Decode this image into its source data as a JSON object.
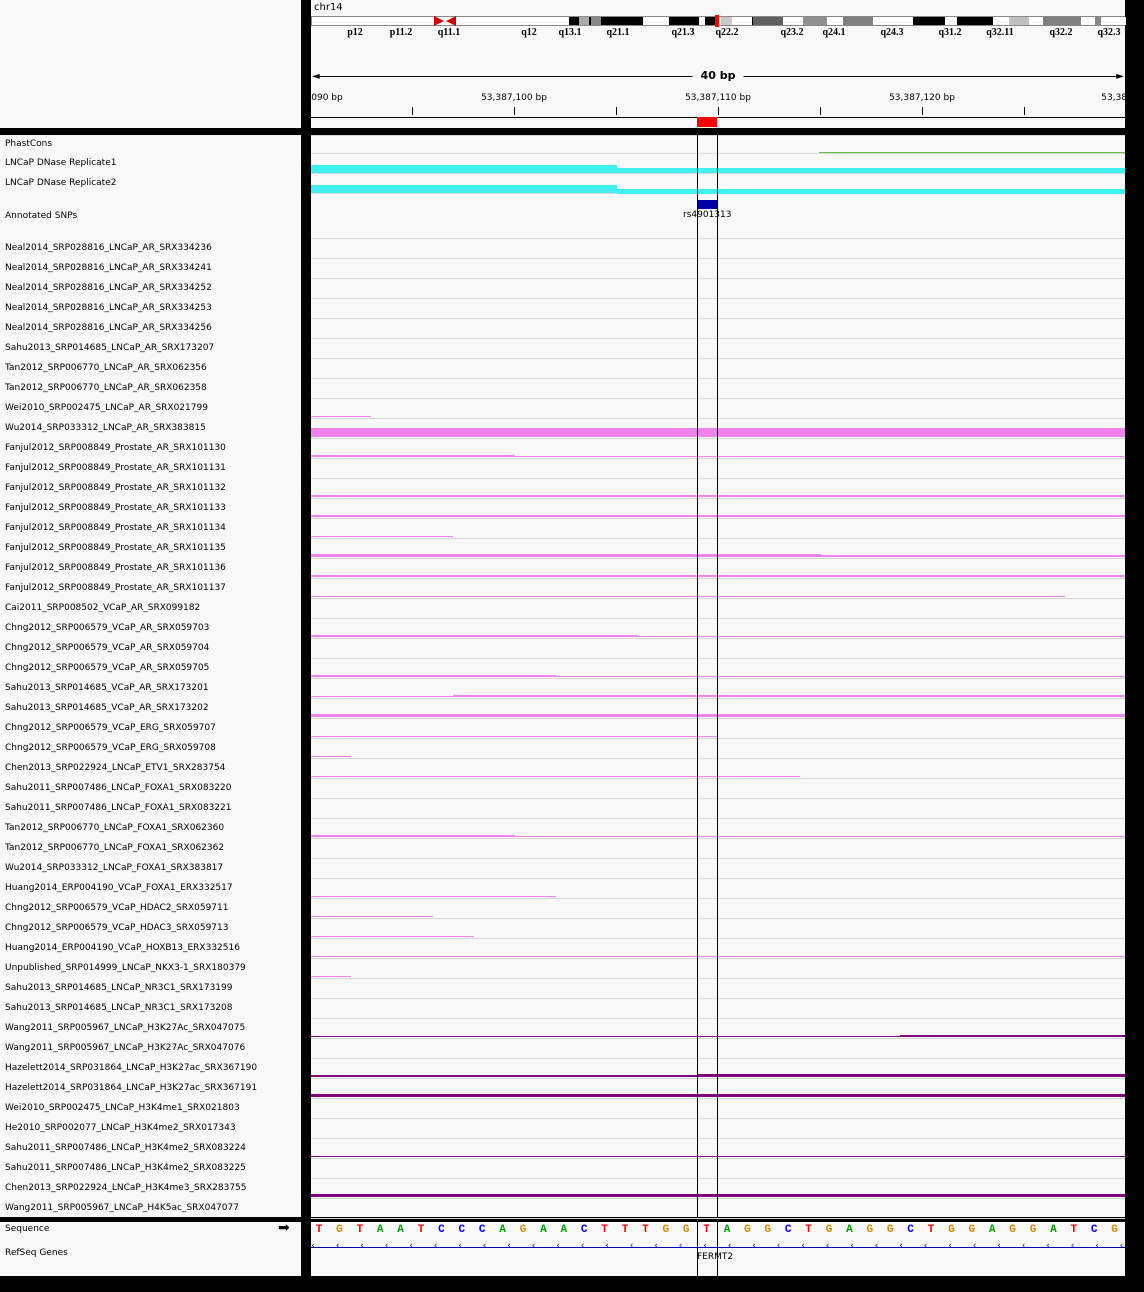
{
  "header": {
    "chromosome": "chr14",
    "bands": [
      "p12",
      "p11.2",
      "q11.1",
      "q12",
      "q13.1",
      "q21.1",
      "q21.3",
      "q22.2",
      "q23.2",
      "q24.1",
      "q24.3",
      "q31.2",
      "q32.11",
      "q32.2",
      "q32.3"
    ],
    "span_label": "40 bp",
    "ruler_labels": [
      "090 bp",
      "53,387,100 bp",
      "53,387,110 bp",
      "53,387,120 bp",
      "53,387"
    ]
  },
  "fixed_tracks": [
    "PhastCons",
    "LNCaP DNase Replicate1",
    "LNCaP DNase Replicate2",
    "Annotated SNPs"
  ],
  "snp": {
    "id": "rs4901313"
  },
  "tracks": [
    "Neal2014_SRP028816_LNCaP_AR_SRX334236",
    "Neal2014_SRP028816_LNCaP_AR_SRX334241",
    "Neal2014_SRP028816_LNCaP_AR_SRX334252",
    "Neal2014_SRP028816_LNCaP_AR_SRX334253",
    "Neal2014_SRP028816_LNCaP_AR_SRX334256",
    "Sahu2013_SRP014685_LNCaP_AR_SRX173207",
    "Tan2012_SRP006770_LNCaP_AR_SRX062356",
    "Tan2012_SRP006770_LNCaP_AR_SRX062358",
    "Wei2010_SRP002475_LNCaP_AR_SRX021799",
    "Wu2014_SRP033312_LNCaP_AR_SRX383815",
    "Fanjul2012_SRP008849_Prostate_AR_SRX101130",
    "Fanjul2012_SRP008849_Prostate_AR_SRX101131",
    "Fanjul2012_SRP008849_Prostate_AR_SRX101132",
    "Fanjul2012_SRP008849_Prostate_AR_SRX101133",
    "Fanjul2012_SRP008849_Prostate_AR_SRX101134",
    "Fanjul2012_SRP008849_Prostate_AR_SRX101135",
    "Fanjul2012_SRP008849_Prostate_AR_SRX101136",
    "Fanjul2012_SRP008849_Prostate_AR_SRX101137",
    "Cai2011_SRP008502_VCaP_AR_SRX099182",
    "Chng2012_SRP006579_VCaP_AR_SRX059703",
    "Chng2012_SRP006579_VCaP_AR_SRX059704",
    "Chng2012_SRP006579_VCaP_AR_SRX059705",
    "Sahu2013_SRP014685_VCaP_AR_SRX173201",
    "Sahu2013_SRP014685_VCaP_AR_SRX173202",
    "Chng2012_SRP006579_VCaP_ERG_SRX059707",
    "Chng2012_SRP006579_VCaP_ERG_SRX059708",
    "Chen2013_SRP022924_LNCaP_ETV1_SRX283754",
    "Sahu2011_SRP007486_LNCaP_FOXA1_SRX083220",
    "Sahu2011_SRP007486_LNCaP_FOXA1_SRX083221",
    "Tan2012_SRP006770_LNCaP_FOXA1_SRX062360",
    "Tan2012_SRP006770_LNCaP_FOXA1_SRX062362",
    "Wu2014_SRP033312_LNCaP_FOXA1_SRX383817",
    "Huang2014_ERP004190_VCaP_FOXA1_ERX332517",
    "Chng2012_SRP006579_VCaP_HDAC2_SRX059711",
    "Chng2012_SRP006579_VCaP_HDAC3_SRX059713",
    "Huang2014_ERP004190_VCaP_HOXB13_ERX332516",
    "Unpublished_SRP014999_LNCaP_NKX3-1_SRX180379",
    "Sahu2013_SRP014685_LNCaP_NR3C1_SRX173199",
    "Sahu2013_SRP014685_LNCaP_NR3C1_SRX173208",
    "Wang2011_SRP005967_LNCaP_H3K27Ac_SRX047075",
    "Wang2011_SRP005967_LNCaP_H3K27Ac_SRX047076",
    "Hazelett2014_SRP031864_LNCaP_H3K27ac_SRX367190",
    "Hazelett2014_SRP031864_LNCaP_H3K27ac_SRX367191",
    "Wei2010_SRP002475_LNCaP_H3K4me1_SRX021803",
    "He2010_SRP002077_LNCaP_H3K4me2_SRX017343",
    "Sahu2011_SRP007486_LNCaP_H3K4me2_SRX083224",
    "Sahu2011_SRP007486_LNCaP_H3K4me2_SRX083225",
    "Chen2013_SRP022924_LNCaP_H3K4me3_SRX283755",
    "Wang2011_SRP005967_LNCaP_H4K5ac_SRX047077"
  ],
  "feature_tracks": {
    "sequence_label": "Sequence",
    "genes_label": "RefSeq Genes",
    "gene_name": "FERMT2",
    "strand_icon": "right-arrow-icon"
  },
  "sequence": [
    "T",
    "G",
    "T",
    "A",
    "A",
    "T",
    "C",
    "C",
    "C",
    "A",
    "G",
    "A",
    "A",
    "C",
    "T",
    "T",
    "T",
    "G",
    "G",
    "T",
    "A",
    "G",
    "G",
    "C",
    "T",
    "G",
    "A",
    "G",
    "G",
    "C",
    "T",
    "G",
    "G",
    "A",
    "G",
    "G",
    "A",
    "T",
    "C",
    "G"
  ],
  "colors": {
    "A": "#00a000",
    "C": "#0000ff",
    "G": "#d18a00",
    "T": "#ff0000",
    "dnase": "#40f0f0",
    "tf": "#ee82ee",
    "histone": "#800080",
    "snp": "#0000a0",
    "phastcons": "#60c040",
    "highlight": "#ff0000"
  }
}
